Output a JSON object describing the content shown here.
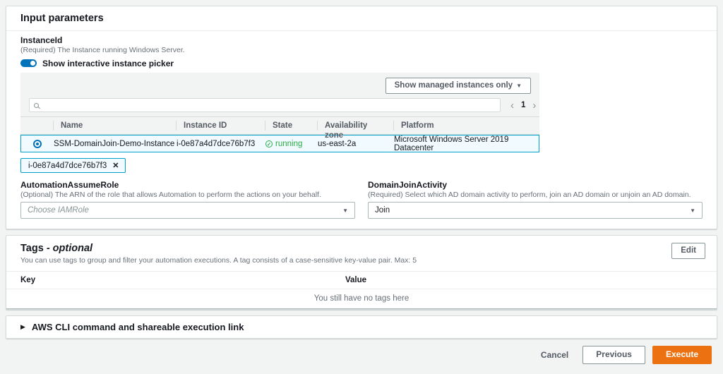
{
  "colors": {
    "accent_blue": "#0073bb",
    "selection_border": "#00a1c9",
    "selection_bg": "#f1faff",
    "status_running_green": "#2bab44",
    "execute_orange": "#ec7211",
    "page_background": "#f2f3f3"
  },
  "icons": {
    "dropdown_arrow": "▼",
    "expander_arrow": "▶",
    "chip_close": "✕",
    "status_check": "✓",
    "page_prev": "‹",
    "page_next": "›"
  },
  "input_parameters": {
    "title": "Input parameters",
    "instance_id": {
      "label": "InstanceId",
      "description": "(Required) The Instance running Windows Server.",
      "toggle_label": "Show interactive instance picker",
      "toggle_state": "on"
    },
    "picker": {
      "filter_button_label": "Show managed instances only",
      "search_value": "",
      "pagination": {
        "current_page": "1"
      },
      "table": {
        "columns": [
          "Name",
          "Instance ID",
          "State",
          "Availability zone",
          "Platform"
        ],
        "rows": [
          {
            "selected": true,
            "name": "SSM-DomainJoin-Demo-Instance",
            "instance_id": "i-0e87a4d7dce76b7f3",
            "state": "running",
            "availability_zone": "us-east-2a",
            "platform": "Microsoft Windows Server 2019 Datacenter"
          }
        ]
      },
      "selected_token": "i-0e87a4d7dce76b7f3"
    },
    "automation_assume_role": {
      "label": "AutomationAssumeRole",
      "description": "(Optional) The ARN of the role that allows Automation to perform the actions on your behalf.",
      "placeholder": "Choose IAMRole"
    },
    "domain_join_activity": {
      "label": "DomainJoinActivity",
      "description": "(Required) Select which AD domain activity to perform, join an AD domain or unjoin an AD domain.",
      "value": "Join"
    }
  },
  "tags_section": {
    "title": "Tags",
    "title_suffix": "- optional",
    "description": "You can use tags to group and filter your automation executions. A tag consists of a case-sensitive key-value pair. Max: 5",
    "edit_button_label": "Edit",
    "columns": [
      "Key",
      "Value"
    ],
    "empty_message": "You still have no tags here"
  },
  "cli_section": {
    "title": "AWS CLI command and shareable execution link"
  },
  "footer": {
    "cancel_label": "Cancel",
    "previous_label": "Previous",
    "execute_label": "Execute"
  }
}
